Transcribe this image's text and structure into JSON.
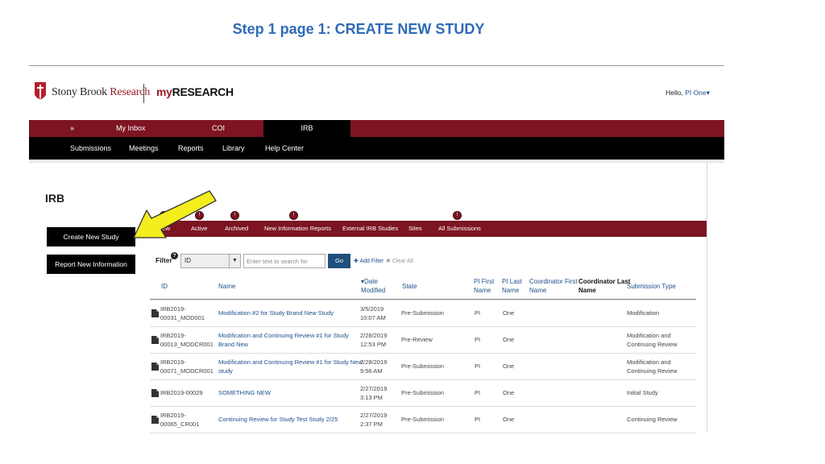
{
  "slide": {
    "title": "Step 1 page 1: CREATE NEW STUDY"
  },
  "header": {
    "brand_a": "Stony Brook",
    "brand_b": "Research",
    "product_a": "my",
    "product_b": "RESEARCH",
    "hello_prefix": "Hello,",
    "hello_user": "PI One",
    "caret": "▾"
  },
  "topnav": {
    "expand": "»",
    "items": [
      "My Inbox",
      "COI",
      "IRB"
    ]
  },
  "subnav": {
    "items": [
      "Submissions",
      "Meetings",
      "Reports",
      "Library",
      "Help Center"
    ]
  },
  "page": {
    "heading": "IRB"
  },
  "side_buttons": {
    "create": "Create New Study",
    "report": "Report New Information"
  },
  "tabs": {
    "items": [
      "view",
      "Active",
      "Archived",
      "New Information Reports",
      "External IRB Studies",
      "Sites",
      "All Submissions"
    ],
    "badge": "!"
  },
  "filter": {
    "label": "Filter",
    "help": "?",
    "field_value": "ID",
    "field_caret": "▼",
    "search_placeholder": "Enter text to search for",
    "go": "Go",
    "add_filter": "Add Filter",
    "clear_all": "Clear All"
  },
  "table": {
    "sort_indicator": "▾",
    "columns": {
      "id": "ID",
      "name": "Name",
      "date_a": "Date",
      "date_b": "Modified",
      "state": "State",
      "pi_first_a": "PI First",
      "pi_first_b": "Name",
      "pi_last_a": "PI Last",
      "pi_last_b": "Name",
      "coord_first_a": "Coordinator First",
      "coord_first_b": "Name",
      "coord_last_a": "Coordinator Last",
      "coord_last_b": "Name",
      "type": "Submission Type"
    },
    "rows": [
      {
        "id_a": "IRB2019-",
        "id_b": "00031_MOD001",
        "name_a": "Modification #2 for Study Brand New Study",
        "name_b": "",
        "date_a": "3/5/2019",
        "date_b": "10:07 AM",
        "state": "Pre-Submission",
        "pi_first": "PI",
        "pi_last": "One",
        "type_a": "Modification",
        "type_b": ""
      },
      {
        "id_a": "IRB2019-",
        "id_b": "00013_MODCR001",
        "name_a": "Modification and Continuing Review #1 for Study",
        "name_b": "Brand New",
        "date_a": "2/28/2019",
        "date_b": "12:53 PM",
        "state": "Pre-Review",
        "pi_first": "PI",
        "pi_last": "One",
        "type_a": "Modification and",
        "type_b": "Continuing Review"
      },
      {
        "id_a": "IRB2019-",
        "id_b": "00071_MODCR001",
        "name_a": "Modification and Continuing Review #1 for Study New",
        "name_b": "study",
        "date_a": "2/28/2019",
        "date_b": "9:56 AM",
        "state": "Pre-Submission",
        "pi_first": "PI",
        "pi_last": "One",
        "type_a": "Modification and",
        "type_b": "Continuing Review"
      },
      {
        "id_a": "IRB2019-00029",
        "id_b": "",
        "name_a": "SOMETHING NEW",
        "name_b": "",
        "date_a": "2/27/2019",
        "date_b": "3:13 PM",
        "state": "Pre-Submission",
        "pi_first": "PI",
        "pi_last": "One",
        "type_a": "Initial Study",
        "type_b": ""
      },
      {
        "id_a": "IRB2019-",
        "id_b": "00065_CR001",
        "name_a": "Continuing Review for Study Test Study 2/25",
        "name_b": "",
        "date_a": "2/27/2019",
        "date_b": "2:37 PM",
        "state": "Pre-Submission",
        "pi_first": "PI",
        "pi_last": "One",
        "type_a": "Continuing Review",
        "type_b": ""
      }
    ]
  },
  "colors": {
    "maroon": "#7d1421",
    "link_blue": "#1f4f8c",
    "title_blue": "#2e6bb8",
    "arrow_yellow": "#f5ee1e"
  },
  "annotations": {
    "arrow": "yellow-arrow-pointing-to-create-new-study"
  }
}
